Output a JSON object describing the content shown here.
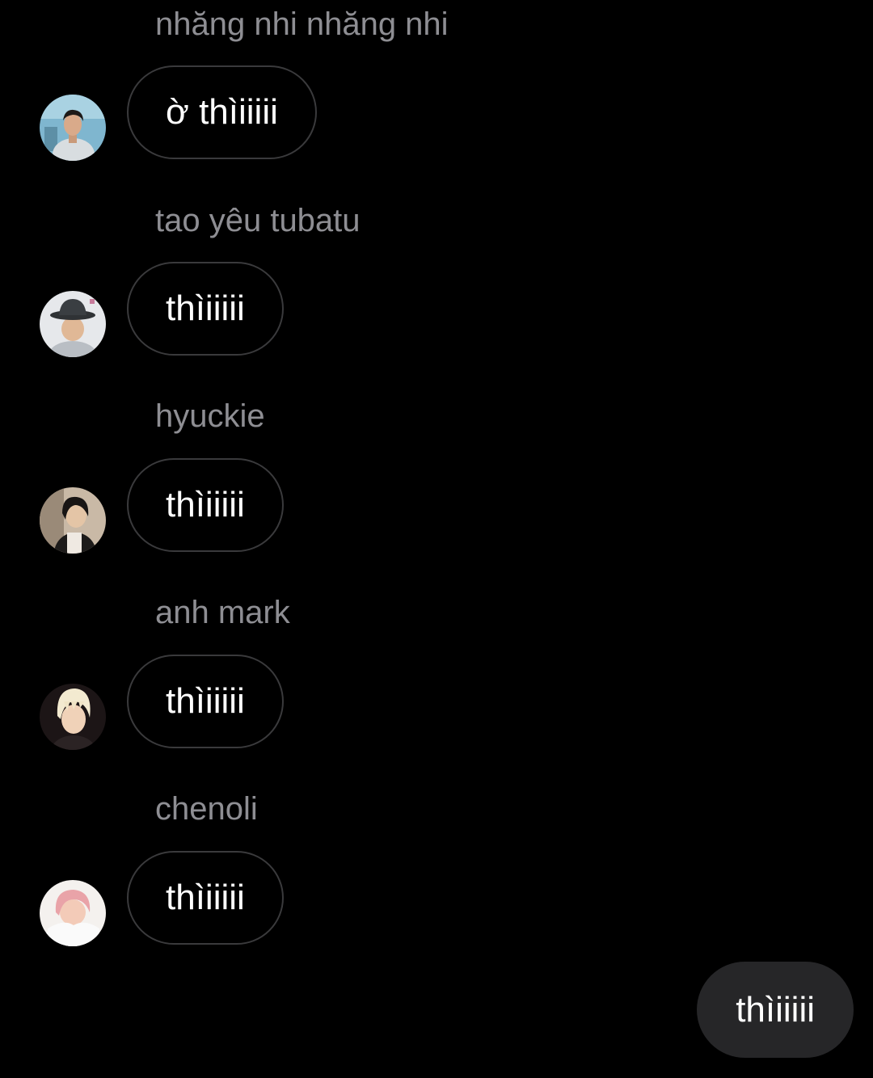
{
  "messages": [
    {
      "sender": "nhăng nhi nhăng nhi",
      "text": "ờ thìiiiii",
      "avatar_icon": "profile-photo-1"
    },
    {
      "sender": "tao yêu tubatu",
      "text": "thìiiiii",
      "avatar_icon": "profile-photo-2"
    },
    {
      "sender": "hyuckie",
      "text": "thìiiiii",
      "avatar_icon": "profile-photo-3"
    },
    {
      "sender": "anh mark",
      "text": "thìiiiii",
      "avatar_icon": "profile-photo-4"
    },
    {
      "sender": "chenoli",
      "text": "thìiiiii",
      "avatar_icon": "profile-photo-5"
    }
  ],
  "outgoing": {
    "text": "thìiiiii"
  },
  "colors": {
    "background": "#000000",
    "sender_name": "#8e8e93",
    "bubble_border": "#3a3a3c",
    "outgoing_bubble": "#262628",
    "text": "#ffffff"
  }
}
